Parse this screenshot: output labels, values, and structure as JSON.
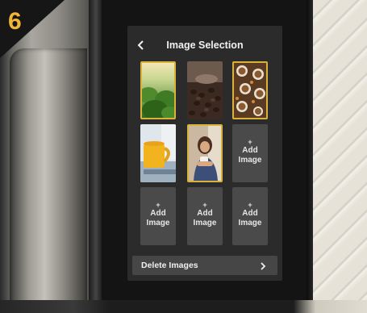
{
  "step": {
    "number": "6",
    "color": "#f3b634"
  },
  "screen": {
    "title": "Image Selection",
    "back_icon": "chevron-left-icon",
    "tiles": [
      {
        "kind": "image",
        "subject": "forest",
        "selected": true
      },
      {
        "kind": "image",
        "subject": "coffee-beans",
        "selected": false
      },
      {
        "kind": "image",
        "subject": "coffee-cups",
        "selected": true
      },
      {
        "kind": "image",
        "subject": "yellow-mug",
        "selected": false
      },
      {
        "kind": "image",
        "subject": "person-with-mug",
        "selected": true
      },
      {
        "kind": "add",
        "plus": "+",
        "label_line1": "Add",
        "label_line2": "Image"
      },
      {
        "kind": "add",
        "plus": "+",
        "label_line1": "Add",
        "label_line2": "Image"
      },
      {
        "kind": "add",
        "plus": "+",
        "label_line1": "Add",
        "label_line2": "Image"
      },
      {
        "kind": "add",
        "plus": "+",
        "label_line1": "Add",
        "label_line2": "Image"
      }
    ],
    "delete": {
      "label": "Delete Images",
      "icon": "chevron-right-icon"
    },
    "accent_color": "#d8b23a"
  }
}
